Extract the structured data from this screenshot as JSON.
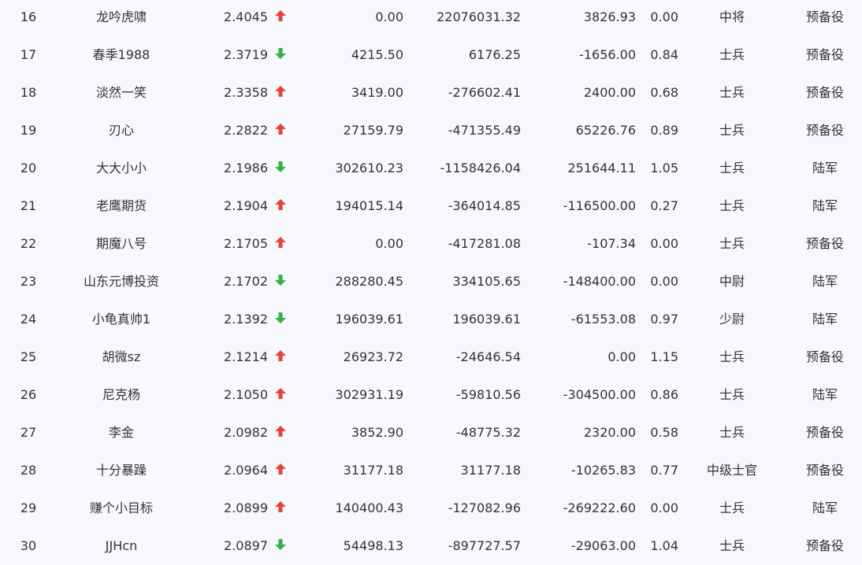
{
  "colors": {
    "up": "#e8413a",
    "down": "#2fb344",
    "text": "#333333",
    "background": "#f6f8fb"
  },
  "rows": [
    {
      "rank": "16",
      "name": "龙吟虎啸",
      "score": "2.4045",
      "trend": "up",
      "v1": "0.00",
      "v2": "22076031.32",
      "v3": "3826.93",
      "ratio": "0.00",
      "level": "中将",
      "branch": "预备役"
    },
    {
      "rank": "17",
      "name": "春季1988",
      "score": "2.3719",
      "trend": "down",
      "v1": "4215.50",
      "v2": "6176.25",
      "v3": "-1656.00",
      "ratio": "0.84",
      "level": "士兵",
      "branch": "预备役"
    },
    {
      "rank": "18",
      "name": "淡然一笑",
      "score": "2.3358",
      "trend": "up",
      "v1": "3419.00",
      "v2": "-276602.41",
      "v3": "2400.00",
      "ratio": "0.68",
      "level": "士兵",
      "branch": "预备役"
    },
    {
      "rank": "19",
      "name": "刃心",
      "score": "2.2822",
      "trend": "up",
      "v1": "27159.79",
      "v2": "-471355.49",
      "v3": "65226.76",
      "ratio": "0.89",
      "level": "士兵",
      "branch": "预备役"
    },
    {
      "rank": "20",
      "name": "大大小小",
      "score": "2.1986",
      "trend": "down",
      "v1": "302610.23",
      "v2": "-1158426.04",
      "v3": "251644.11",
      "ratio": "1.05",
      "level": "士兵",
      "branch": "陆军"
    },
    {
      "rank": "21",
      "name": "老鹰期货",
      "score": "2.1904",
      "trend": "up",
      "v1": "194015.14",
      "v2": "-364014.85",
      "v3": "-116500.00",
      "ratio": "0.27",
      "level": "士兵",
      "branch": "陆军"
    },
    {
      "rank": "22",
      "name": "期魔八号",
      "score": "2.1705",
      "trend": "up",
      "v1": "0.00",
      "v2": "-417281.08",
      "v3": "-107.34",
      "ratio": "0.00",
      "level": "士兵",
      "branch": "预备役"
    },
    {
      "rank": "23",
      "name": "山东元博投资",
      "score": "2.1702",
      "trend": "down",
      "v1": "288280.45",
      "v2": "334105.65",
      "v3": "-148400.00",
      "ratio": "0.00",
      "level": "中尉",
      "branch": "陆军"
    },
    {
      "rank": "24",
      "name": "小龟真帅1",
      "score": "2.1392",
      "trend": "down",
      "v1": "196039.61",
      "v2": "196039.61",
      "v3": "-61553.08",
      "ratio": "0.97",
      "level": "少尉",
      "branch": "陆军"
    },
    {
      "rank": "25",
      "name": "胡微sz",
      "score": "2.1214",
      "trend": "up",
      "v1": "26923.72",
      "v2": "-24646.54",
      "v3": "0.00",
      "ratio": "1.15",
      "level": "士兵",
      "branch": "预备役"
    },
    {
      "rank": "26",
      "name": "尼克杨",
      "score": "2.1050",
      "trend": "up",
      "v1": "302931.19",
      "v2": "-59810.56",
      "v3": "-304500.00",
      "ratio": "0.86",
      "level": "士兵",
      "branch": "陆军"
    },
    {
      "rank": "27",
      "name": "李金",
      "score": "2.0982",
      "trend": "up",
      "v1": "3852.90",
      "v2": "-48775.32",
      "v3": "2320.00",
      "ratio": "0.58",
      "level": "士兵",
      "branch": "预备役"
    },
    {
      "rank": "28",
      "name": "十分暴躁",
      "score": "2.0964",
      "trend": "up",
      "v1": "31177.18",
      "v2": "31177.18",
      "v3": "-10265.83",
      "ratio": "0.77",
      "level": "中级士官",
      "branch": "预备役"
    },
    {
      "rank": "29",
      "name": "赚个小目标",
      "score": "2.0899",
      "trend": "up",
      "v1": "140400.43",
      "v2": "-127082.96",
      "v3": "-269222.60",
      "ratio": "0.00",
      "level": "士兵",
      "branch": "陆军"
    },
    {
      "rank": "30",
      "name": "JJHcn",
      "score": "2.0897",
      "trend": "down",
      "v1": "54498.13",
      "v2": "-897727.57",
      "v3": "-29063.00",
      "ratio": "1.04",
      "level": "士兵",
      "branch": "预备役"
    }
  ]
}
